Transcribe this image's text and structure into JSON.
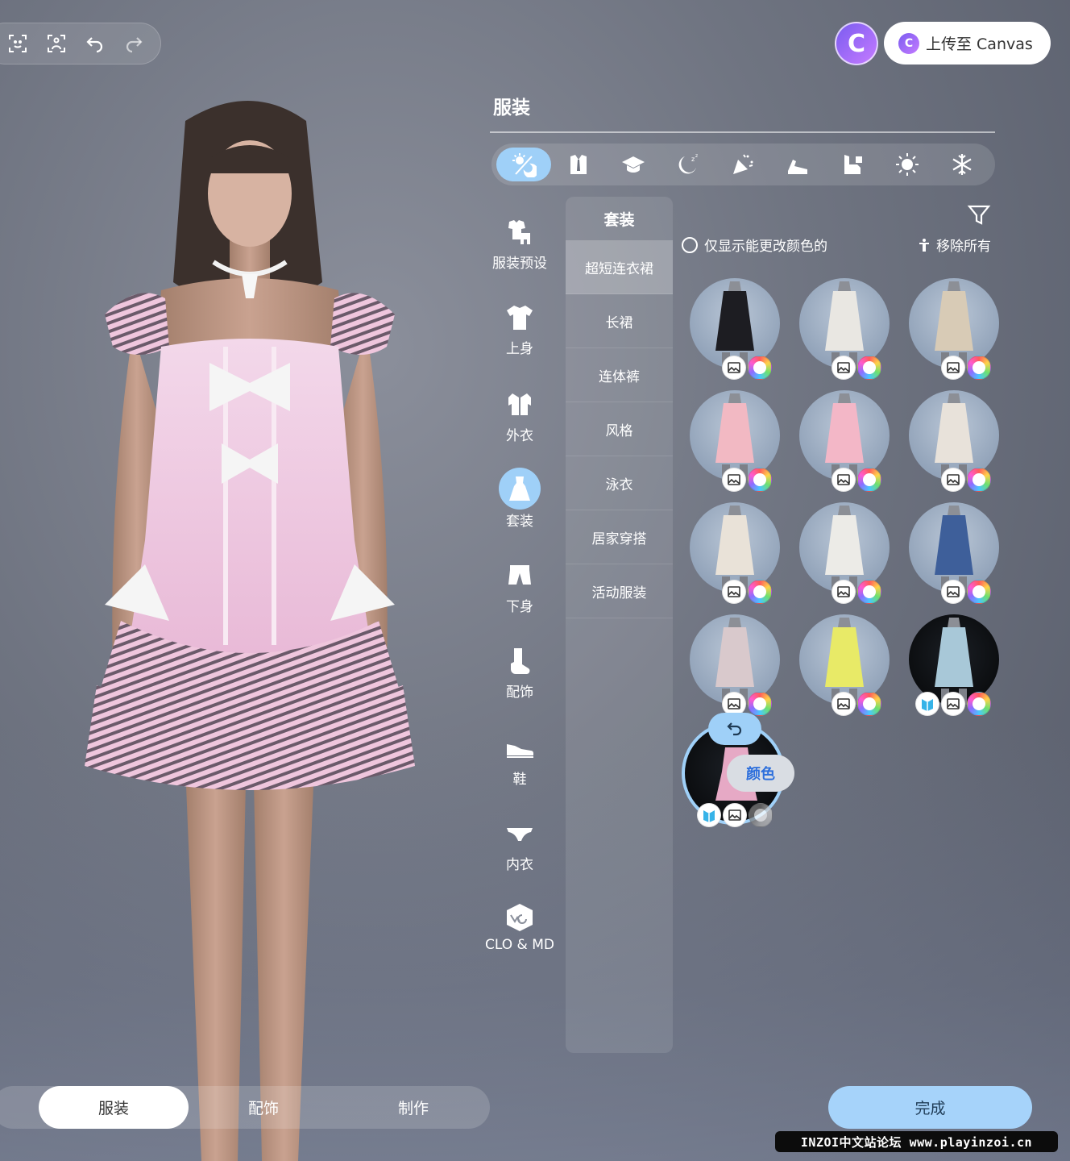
{
  "topbar": {
    "toolbar_icons": [
      "face-scan-icon",
      "body-scan-icon",
      "undo-icon",
      "redo-icon"
    ],
    "canvas_logo_letter": "C",
    "upload_label": "上传至 Canvas"
  },
  "panel": {
    "title": "服装",
    "season_tabs": [
      "all-weather-icon",
      "formal-icon",
      "school-icon",
      "sleep-icon",
      "party-icon",
      "sport-icon",
      "outdoor-icon",
      "summer-icon",
      "winter-icon"
    ],
    "active_season_tab": 0
  },
  "side_menu": {
    "items": [
      {
        "label": "服装预设",
        "icon": "outfit-preset-icon"
      },
      {
        "label": "上身",
        "icon": "top-icon"
      },
      {
        "label": "外衣",
        "icon": "outerwear-icon"
      },
      {
        "label": "套装",
        "icon": "dress-icon"
      },
      {
        "label": "下身",
        "icon": "bottom-icon"
      },
      {
        "label": "配饰",
        "icon": "sock-icon"
      },
      {
        "label": "鞋",
        "icon": "shoe-icon"
      },
      {
        "label": "内衣",
        "icon": "underwear-icon"
      },
      {
        "label": "CLO & MD",
        "icon": "clo-md-icon"
      }
    ],
    "active_index": 3
  },
  "sub_menu": {
    "header": "套装",
    "items": [
      "超短连衣裙",
      "长裙",
      "连体裤",
      "风格",
      "泳衣",
      "居家穿搭",
      "活动服装"
    ],
    "active_index": 0
  },
  "filters": {
    "only_color_label": "仅显示能更改颜色的",
    "remove_all_label": "移除所有"
  },
  "outfits": [
    {
      "color": "#1d1d22",
      "dark": false,
      "md": false
    },
    {
      "color": "#e9e7e2",
      "dark": false,
      "md": false
    },
    {
      "color": "#d8cbb6",
      "dark": false,
      "md": false
    },
    {
      "color": "#f2b9c3",
      "dark": false,
      "md": false
    },
    {
      "color": "#f3b7c7",
      "dark": false,
      "md": false
    },
    {
      "color": "#e8e2da",
      "dark": false,
      "md": false
    },
    {
      "color": "#e9e2d8",
      "dark": false,
      "md": false
    },
    {
      "color": "#ecebe7",
      "dark": false,
      "md": false
    },
    {
      "color": "#3e5f9a",
      "dark": false,
      "md": false
    },
    {
      "color": "#d9c9cc",
      "dark": false,
      "md": false
    },
    {
      "color": "#e8ea67",
      "dark": false,
      "md": false
    },
    {
      "color": "#a8c8d8",
      "dark": true,
      "md": true
    }
  ],
  "selected_outfit": {
    "color": "#e6a9c5",
    "color_button_label": "颜色"
  },
  "bottom_tabs": [
    "服装",
    "配饰",
    "制作"
  ],
  "bottom_active": 0,
  "done_label": "完成",
  "watermark": "INZOI中文站论坛 www.playinzoi.cn"
}
